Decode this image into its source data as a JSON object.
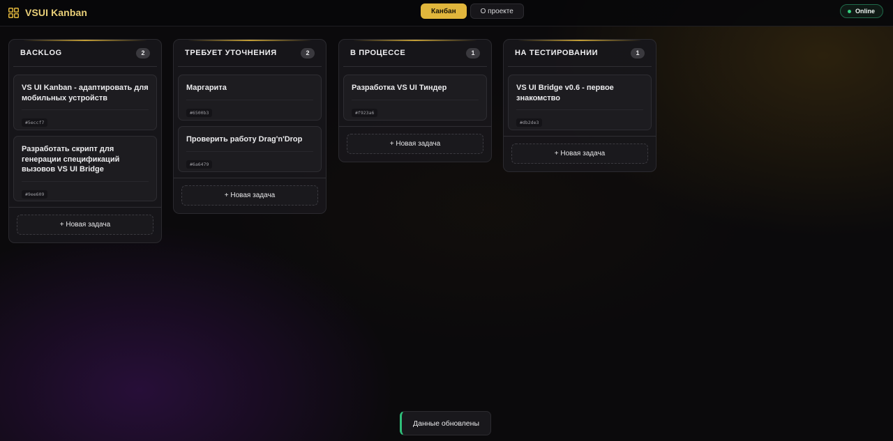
{
  "app": {
    "title": "VSUI Kanban",
    "icon": "grid-icon",
    "accent_color": "#e1b63c"
  },
  "nav": {
    "items": [
      {
        "label": "Канбан",
        "active": true
      },
      {
        "label": "О проекте",
        "active": false
      }
    ]
  },
  "status": {
    "label": "Online",
    "color": "#35d07f"
  },
  "board": {
    "new_task_label": "+ Новая задача",
    "columns": [
      {
        "title": "BACKLOG",
        "count": "2",
        "cards": [
          {
            "title": "VS UI Kanban - адаптировать для мобильных устройств",
            "id": "#5eccf7"
          },
          {
            "title": "Разработать скрипт для генерации спецификаций вызовов VS UI Bridge",
            "id": "#9ee609"
          }
        ]
      },
      {
        "title": "ТРЕБУЕТ УТОЧНЕНИЯ",
        "count": "2",
        "cards": [
          {
            "title": "Маргарита",
            "id": "#6500b3"
          },
          {
            "title": "Проверить работу Drag'n'Drop",
            "id": "#6a6479"
          }
        ]
      },
      {
        "title": "В ПРОЦЕССЕ",
        "count": "1",
        "cards": [
          {
            "title": "Разработка VS UI Тиндер",
            "id": "#f923a6"
          }
        ]
      },
      {
        "title": "НА ТЕСТИРОВАНИИ",
        "count": "1",
        "cards": [
          {
            "title": "VS UI Bridge v0.6 - первое знакомство",
            "id": "#db2de3"
          }
        ]
      }
    ]
  },
  "toast": {
    "message": "Данные обновлены",
    "color": "#2fbf7a"
  }
}
